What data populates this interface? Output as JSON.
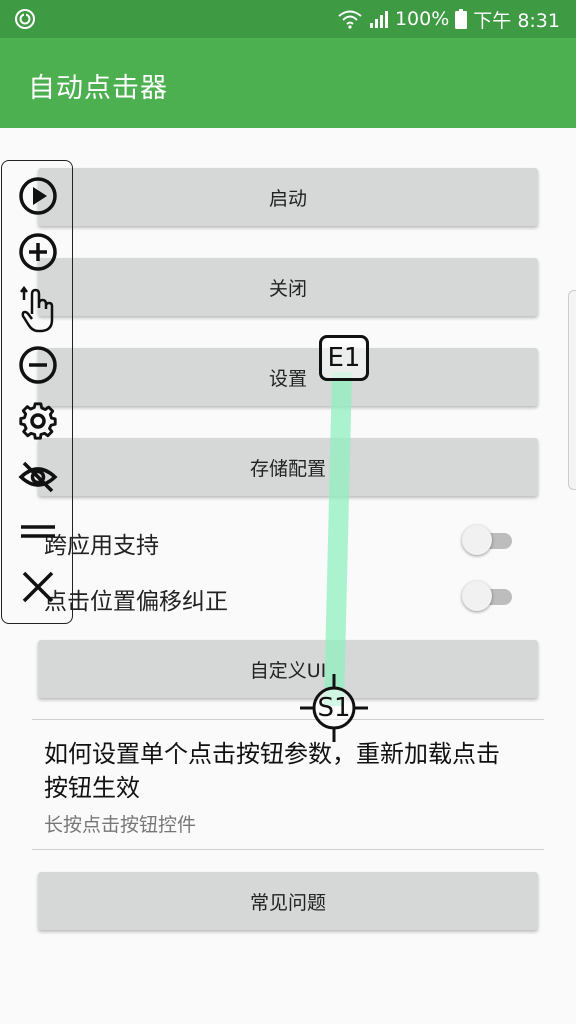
{
  "status_bar": {
    "battery_percent": "100%",
    "time": "下午 8:31",
    "icons": [
      "app-notification-icon",
      "wifi-icon",
      "signal-icon",
      "battery-icon"
    ]
  },
  "app_bar": {
    "title": "自动点击器"
  },
  "buttons": {
    "start": "启动",
    "close": "关闭",
    "settings": "设置",
    "save_config": "存储配置",
    "custom_ui": "自定义UI",
    "faq": "常见问题"
  },
  "toggles": [
    {
      "label": "跨应用支持",
      "on": false
    },
    {
      "label": "点击位置偏移纠正",
      "on": false
    }
  ],
  "info": {
    "title": "如何设置单个点击按钮参数，重新加载点击按钮生效",
    "subtitle": "长按点击按钮控件"
  },
  "floating_toolbar": {
    "icons": [
      "play-icon",
      "add-icon",
      "swipe-gesture-icon",
      "remove-icon",
      "gear-icon",
      "hide-eye-icon",
      "drag-handle-icon",
      "close-icon"
    ]
  },
  "swipe_markers": {
    "end_label": "E1",
    "start_label": "S1"
  },
  "colors": {
    "status_bar": "#3e9a43",
    "app_bar": "#4caf50",
    "button": "#d6d7d7",
    "swipe_trail": "#90f0c0"
  }
}
